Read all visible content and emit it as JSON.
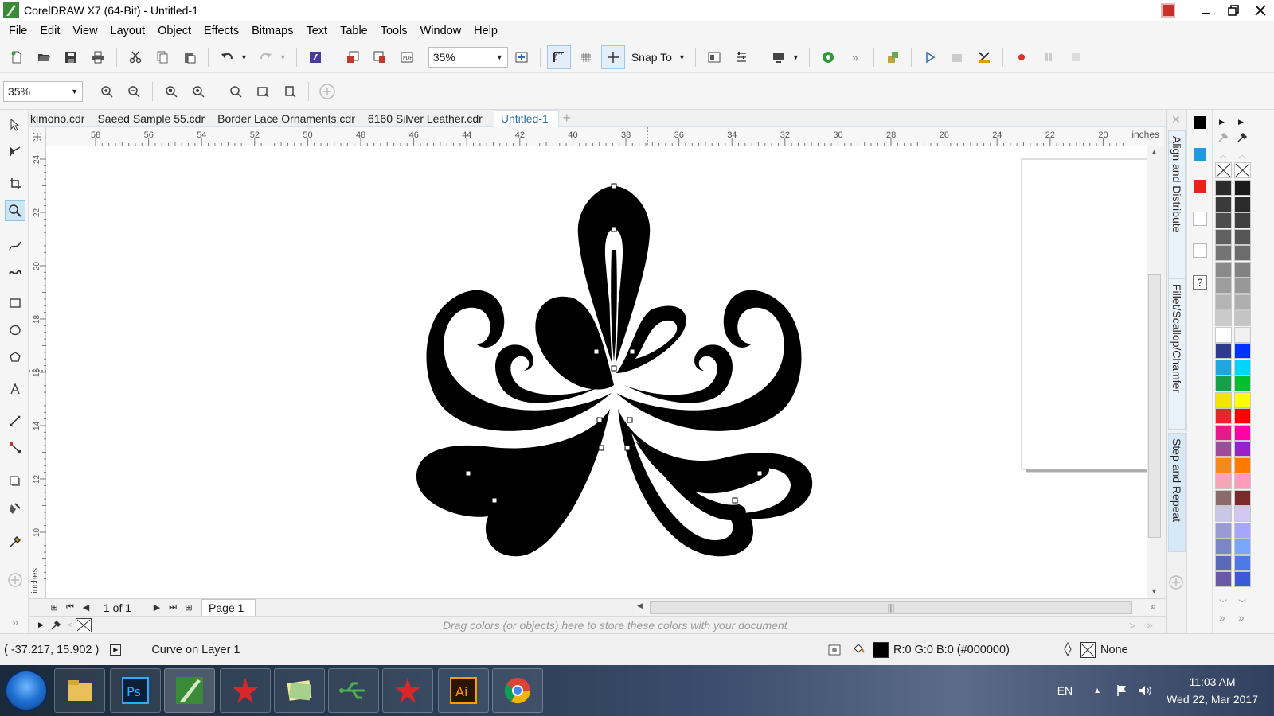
{
  "window": {
    "title": "CorelDRAW X7 (64-Bit) - Untitled-1"
  },
  "menu": [
    "File",
    "Edit",
    "View",
    "Layout",
    "Object",
    "Effects",
    "Bitmaps",
    "Text",
    "Table",
    "Tools",
    "Window",
    "Help"
  ],
  "toolbar1": {
    "zoom_value": "35%",
    "snap_label": "Snap To"
  },
  "toolbar2": {
    "zoom_value": "35%"
  },
  "tabs": [
    "kimono.cdr",
    "Saeed Sample 55.cdr",
    "Border Lace Ornaments.cdr",
    "6160 Silver Leather.cdr",
    "Untitled-1"
  ],
  "ruler": {
    "h_ticks": [
      "58",
      "56",
      "54",
      "52",
      "50",
      "48",
      "46",
      "44",
      "42",
      "40",
      "38",
      "36",
      "34",
      "32",
      "30",
      "28",
      "26",
      "24",
      "22",
      "20"
    ],
    "h_unit": "inches",
    "v_ticks": [
      "24",
      "22",
      "20",
      "18",
      "16",
      "14",
      "12",
      "10"
    ],
    "v_unit": "inches"
  },
  "navigator": {
    "page_count": "1 of 1",
    "page_tab": "Page 1"
  },
  "docpalette": {
    "hint": "Drag colors (or objects) here to store these colors with your document"
  },
  "status": {
    "coords": "( -37.217, 15.902 )",
    "object_info": "Curve on Layer 1",
    "fill_info": "R:0 G:0 B:0 (#000000)",
    "outline_info": "None",
    "fill_color": "#000000"
  },
  "dockers": [
    "Align and Distribute",
    "Fillet/Scallop/Chamfer",
    "Step and Repeat"
  ],
  "palette": {
    "col1": [
      "#2b2b2b",
      "#3a3a3a",
      "#4d4d4d",
      "#606060",
      "#747474",
      "#8a8a8a",
      "#9e9e9e",
      "#b4b4b4",
      "#cacaca",
      "#ffffff",
      "#2e3a8c",
      "#1ea6e0",
      "#14a04a",
      "#f2e600",
      "#e6262b",
      "#e6188a",
      "#a04a9c",
      "#f28a1e",
      "#f4a6b4",
      "#8a6a6a",
      "#c8c8e6",
      "#9a9ad6",
      "#7a86c6",
      "#5a6ab6",
      "#6a5aa6"
    ],
    "col2": [
      "#1a1a1a",
      "#2a2a2a",
      "#404040",
      "#565656",
      "#6c6c6c",
      "#828282",
      "#989898",
      "#aeaeae",
      "#c4c4c4",
      "#f0f0f0",
      "#0033ff",
      "#00d4ff",
      "#00c030",
      "#ffff00",
      "#ff0000",
      "#ff00aa",
      "#9a20c8",
      "#ff7a00",
      "#ff9ab8",
      "#7a2a2a",
      "#d0c8f0",
      "#a6a6ff",
      "#7aa6ff",
      "#4a7ae6",
      "#3a5ad6"
    ],
    "mini": [
      "#000000",
      "#1e9be0",
      "#e8211c"
    ]
  },
  "taskbar": {
    "lang": "EN",
    "time": "11:03 AM",
    "date": "Wed 22, Mar 2017",
    "apps": [
      "file-explorer",
      "photoshop",
      "coreldraw",
      "red-app",
      "notes-app",
      "usb-app",
      "red-app-2",
      "illustrator",
      "chrome"
    ]
  }
}
